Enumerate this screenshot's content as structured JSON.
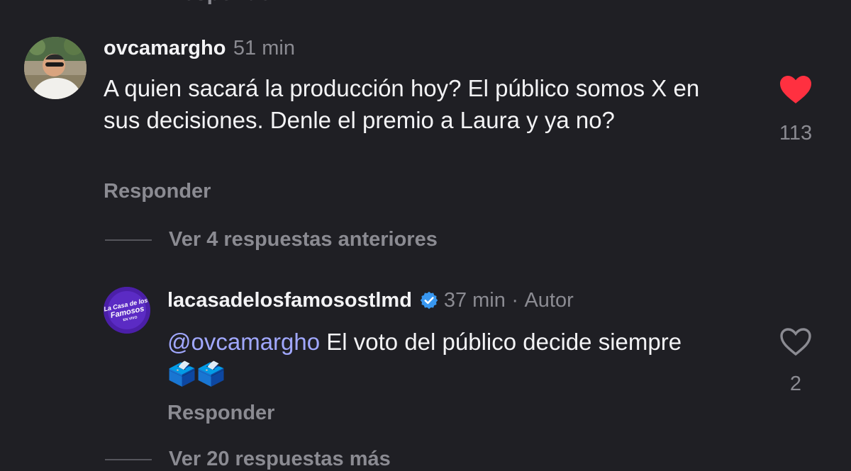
{
  "top_reply_label": "Responder",
  "comment": {
    "username": "ovcamargho",
    "time": "51 min",
    "text": "A quien sacará la producción hoy? El público somos X en sus decisiones. Denle el premio a Laura y ya no?",
    "reply_label": "Responder",
    "likes": "113",
    "liked": true,
    "like_color": "#ff3040"
  },
  "view_previous_replies": "Ver 4 respuestas anteriores",
  "reply": {
    "username": "lacasadelosfamosostlmd",
    "verified": true,
    "time": "37 min",
    "separator": "·",
    "author_tag": "Autor",
    "mention": "@ovcamargho",
    "text": " El voto del público decide siempre ",
    "emoji": "🗳️🗳️",
    "reply_label": "Responder",
    "likes": "2",
    "liked": false,
    "avatar_text": [
      "La Casa de los",
      "Famosos",
      "EN VIVO"
    ]
  },
  "view_more_replies": "Ver 20 respuestas más",
  "colors": {
    "background": "#1f1f24",
    "text_primary": "#f3f3f5",
    "text_secondary": "#8b8b92",
    "mention": "#a1a8ff",
    "verified": "#3897f0"
  }
}
